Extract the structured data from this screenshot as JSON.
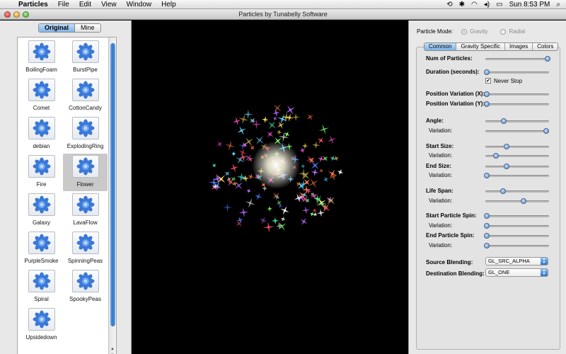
{
  "menubar": {
    "app_name": "Particles",
    "items": [
      "File",
      "Edit",
      "View",
      "Window",
      "Help"
    ],
    "clock": "Sun 8:53 PM"
  },
  "window": {
    "title": "Particles by Tunabelly Software"
  },
  "sidebar": {
    "segments": [
      {
        "label": "Original",
        "selected": true
      },
      {
        "label": "Mine",
        "selected": false
      }
    ],
    "presets": [
      "BoilingFoam",
      "BurstPipe",
      "Comet",
      "CottonCandy",
      "debian",
      "ExplodingRing",
      "Fire",
      "Flower",
      "Galaxy",
      "LavaFlow",
      "PurpleSmoke",
      "SpinningPeas",
      "Spiral",
      "SpookyPeas",
      "Upsidedown"
    ],
    "selected": "Flower"
  },
  "mode": {
    "label": "Particle Mode:",
    "options": [
      "Gravity",
      "Radial"
    ],
    "selected": "Gravity"
  },
  "tabs": [
    {
      "label": "Common",
      "selected": true
    },
    {
      "label": "Gravity Specific",
      "selected": false
    },
    {
      "label": "Images",
      "selected": false
    },
    {
      "label": "Colors",
      "selected": false
    }
  ],
  "params": {
    "num_particles": {
      "label": "Num of Particles:",
      "value": 1.0
    },
    "duration": {
      "label": "Duration (seconds):",
      "value": 0.0
    },
    "never_stop": {
      "label": "Never Stop",
      "checked": true
    },
    "pos_var_x": {
      "label": "Position Variation (X):",
      "value": 0.0
    },
    "pos_var_y": {
      "label": "Position Variation (Y):",
      "value": 0.0
    },
    "angle": {
      "label": "Angle:",
      "value": 0.28
    },
    "angle_var": {
      "label": "Variation:",
      "value": 0.98
    },
    "start_size": {
      "label": "Start Size:",
      "value": 0.32
    },
    "start_size_var": {
      "label": "Variation:",
      "value": 0.15
    },
    "end_size": {
      "label": "End Size:",
      "value": 0.32
    },
    "end_size_var": {
      "label": "Variation:",
      "value": 0.0
    },
    "life_span": {
      "label": "Life Span:",
      "value": 0.27
    },
    "life_span_var": {
      "label": "Variation:",
      "value": 0.6
    },
    "start_spin": {
      "label": "Start Particle Spin:",
      "value": 0.0
    },
    "start_spin_var": {
      "label": "Variation:",
      "value": 0.0
    },
    "end_spin": {
      "label": "End Particle Spin:",
      "value": 0.0
    },
    "end_spin_var": {
      "label": "Variation:",
      "value": 0.0
    }
  },
  "blending": {
    "source": {
      "label": "Source Blending:",
      "value": "GL_SRC_ALPHA"
    },
    "destination": {
      "label": "Destination Blending:",
      "value": "GL_ONE"
    }
  },
  "colors": {
    "selection": "#7fb3e6",
    "slider_knob": "#4b8fe0",
    "canvas_bg": "#000000"
  }
}
